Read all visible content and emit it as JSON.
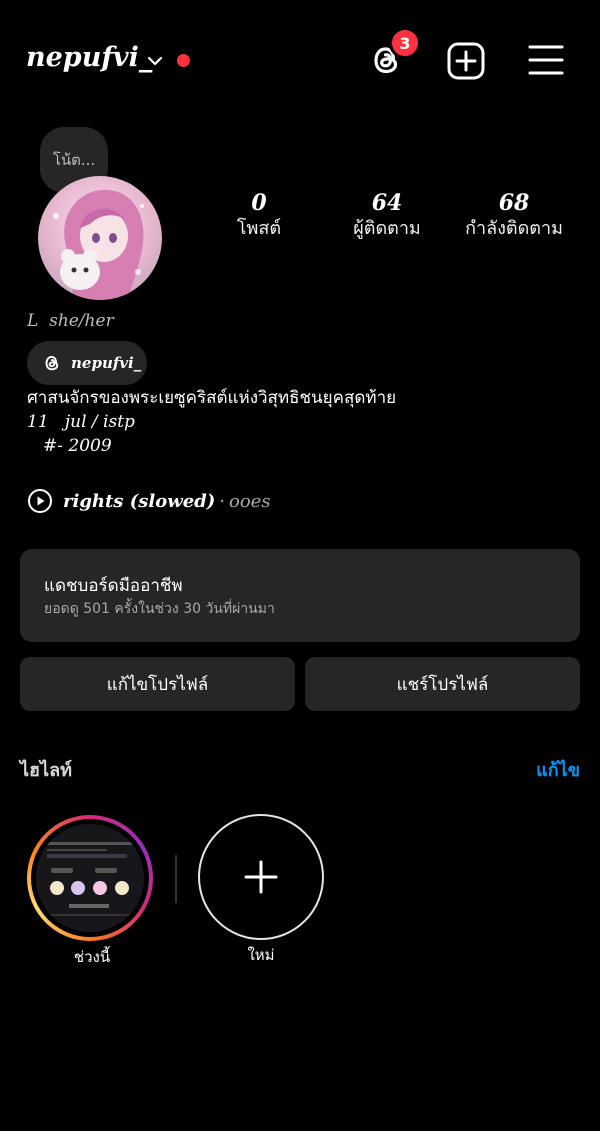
{
  "header": {
    "username": "nepufvi_",
    "threads_badge_count": "3",
    "icons": [
      "chevron-down-icon",
      "threads-icon",
      "new-post-icon",
      "menu-icon"
    ],
    "accent_red": "#ff3040"
  },
  "profile": {
    "note": "โน้ต...",
    "stats": [
      {
        "value": "0",
        "label": "โพสต์"
      },
      {
        "value": "64",
        "label": "ผู้ติดตาม"
      },
      {
        "value": "68",
        "label": "กำลังติดตาม"
      }
    ],
    "pronouns": "L  she/her",
    "threads_handle": "nepufvi_",
    "bio": [
      "ศาสนจักรของพระเยซูคริสต์แห่งวิสุทธิชนยุคสุดท้าย",
      "11   jul / istp",
      "#- 2009"
    ],
    "music": {
      "song": "rights (slowed)",
      "separator": "·",
      "artist": "ooes"
    }
  },
  "dashboard": {
    "title": "แดชบอร์ดมืออาชีพ",
    "subtitle": "ยอดดู 501 ครั้งในช่วง 30 วันที่ผ่านมา"
  },
  "buttons": {
    "edit_profile": "แก้ไขโปรไฟล์",
    "share_profile": "แชร์โปรไฟล์"
  },
  "highlights": {
    "title": "ไฮไลท์",
    "edit": "แก้ไข",
    "edit_color": "#0095f6",
    "items": [
      {
        "label": "ช่วงนี้"
      }
    ],
    "new_label": "ใหม่"
  }
}
